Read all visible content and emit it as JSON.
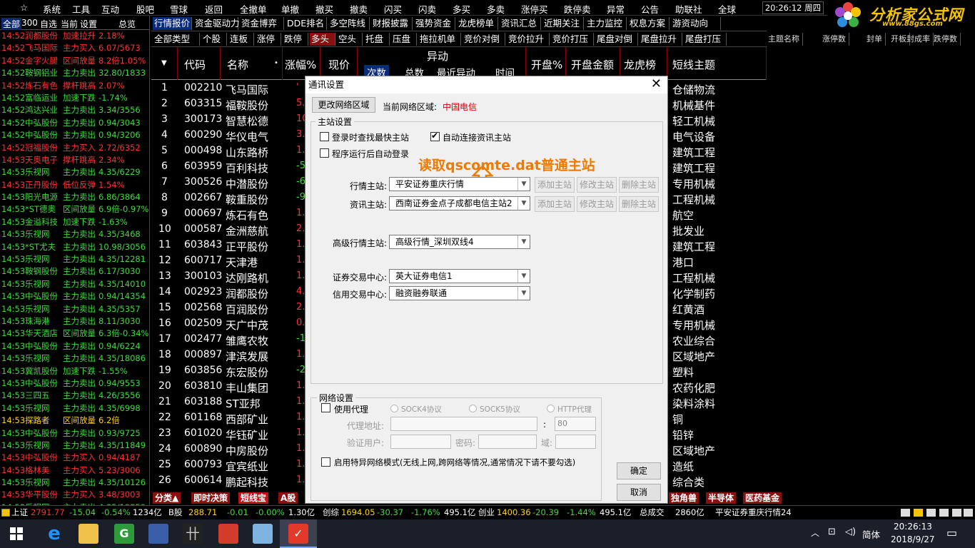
{
  "menu": [
    "☆",
    "系统",
    "工具",
    "互动",
    "股吧",
    "雪球",
    "返回",
    "全撤单",
    "单撤",
    "撤买",
    "撤卖",
    "闪买",
    "闪卖",
    "多买",
    "多卖",
    "涨停买",
    "跌停卖",
    "异常",
    "公告",
    "助联社",
    "全球"
  ],
  "clock": {
    "time": "20:26:12",
    "weekday": "周四"
  },
  "logo": {
    "title": "分析家公式网",
    "url": "www.88gs.com"
  },
  "left_tabs": [
    "全部",
    "300",
    "自选",
    "当前",
    "设置",
    "总览"
  ],
  "feed": [
    {
      "t": "14:52",
      "name": "润都股份",
      "act": "加速拉升",
      "val": "2.18%",
      "c": "r"
    },
    {
      "t": "14:52",
      "name": "飞马国际",
      "act": "主力买入",
      "val": "6.07/5673",
      "c": "r"
    },
    {
      "t": "14:52",
      "name": "金字火腿",
      "act": "区间放量",
      "val": "8.2倍1.05%",
      "c": "r"
    },
    {
      "t": "14:52",
      "name": "鞍钢铝业",
      "act": "主力卖出",
      "val": "32.80/1833",
      "c": "g"
    },
    {
      "t": "14:52",
      "name": "炼石有色",
      "act": "撑杆跳高",
      "val": "2.07%",
      "c": "r"
    },
    {
      "t": "14:52",
      "name": "富临运业",
      "act": "加速下跌",
      "val": "-1.74%",
      "c": "g"
    },
    {
      "t": "14:52",
      "name": "鸿达兴业",
      "act": "主力卖出",
      "val": "3.34/3556",
      "c": "g"
    },
    {
      "t": "14:52",
      "name": "中弘股份",
      "act": "主力卖出",
      "val": "0.94/3043",
      "c": "g"
    },
    {
      "t": "14:52",
      "name": "中弘股份",
      "act": "主力卖出",
      "val": "0.94/3206",
      "c": "g"
    },
    {
      "t": "14:52",
      "name": "冠福股份",
      "act": "主力买入",
      "val": "2.72/6352",
      "c": "r"
    },
    {
      "t": "14:53",
      "name": "天奥电子",
      "act": "撑杆跳高",
      "val": "2.34%",
      "c": "r"
    },
    {
      "t": "14:53",
      "name": "乐视网",
      "act": "主力卖出",
      "val": "4.35/6229",
      "c": "g"
    },
    {
      "t": "14:53",
      "name": "正丹股份",
      "act": "低位反弹",
      "val": "1.54%",
      "c": "r"
    },
    {
      "t": "14:53",
      "name": "阳光电源",
      "act": "主力卖出",
      "val": "6.86/3864",
      "c": "g"
    },
    {
      "t": "14:53",
      "name": "*ST德奥",
      "act": "区间放量",
      "val": "6.9倍-0.97%",
      "c": "g"
    },
    {
      "t": "14:53",
      "name": "金溢科技",
      "act": "加速下跌",
      "val": "-1.63%",
      "c": "g"
    },
    {
      "t": "14:53",
      "name": "乐视网",
      "act": "主力卖出",
      "val": "4.35/3468",
      "c": "g"
    },
    {
      "t": "14:53",
      "name": "*ST尤夫",
      "act": "主力卖出",
      "val": "10.98/3056",
      "c": "g"
    },
    {
      "t": "14:53",
      "name": "乐视网",
      "act": "主力卖出",
      "val": "4.35/12281",
      "c": "g"
    },
    {
      "t": "14:53",
      "name": "鞍钢股份",
      "act": "主力卖出",
      "val": "6.17/3030",
      "c": "g"
    },
    {
      "t": "14:53",
      "name": "乐视网",
      "act": "主力卖出",
      "val": "4.35/14010",
      "c": "g"
    },
    {
      "t": "14:53",
      "name": "中弘股份",
      "act": "主力卖出",
      "val": "0.94/14354",
      "c": "g"
    },
    {
      "t": "14:53",
      "name": "乐视网",
      "act": "主力卖出",
      "val": "4.35/5357",
      "c": "g"
    },
    {
      "t": "14:53",
      "name": "珠海港",
      "act": "主力卖出",
      "val": "8.11/3030",
      "c": "g"
    },
    {
      "t": "14:53",
      "name": "华天酒店",
      "act": "区间放量",
      "val": "6.3倍-0.34%",
      "c": "g"
    },
    {
      "t": "14:53",
      "name": "中弘股份",
      "act": "主力卖出",
      "val": "0.94/6224",
      "c": "g"
    },
    {
      "t": "14:53",
      "name": "乐视网",
      "act": "主力卖出",
      "val": "4.35/18086",
      "c": "g"
    },
    {
      "t": "14:53",
      "name": "冀凯股份",
      "act": "加速下跌",
      "val": "-1.55%",
      "c": "g"
    },
    {
      "t": "14:53",
      "name": "中弘股份",
      "act": "主力卖出",
      "val": "0.94/9553",
      "c": "g"
    },
    {
      "t": "14:53",
      "name": "三四五",
      "act": "主力卖出",
      "val": "4.26/3556",
      "c": "g"
    },
    {
      "t": "14:53",
      "name": "乐视网",
      "act": "主力卖出",
      "val": "4.35/6998",
      "c": "g"
    },
    {
      "t": "14:53",
      "name": "探路者",
      "act": "区间放量",
      "val": "6.2倍",
      "c": "y"
    },
    {
      "t": "14:53",
      "name": "中弘股份",
      "act": "主力卖出",
      "val": "0.93/9725",
      "c": "g"
    },
    {
      "t": "14:53",
      "name": "乐视网",
      "act": "主力卖出",
      "val": "4.35/11849",
      "c": "g"
    },
    {
      "t": "14:53",
      "name": "中弘股份",
      "act": "主力买入",
      "val": "0.94/4187",
      "c": "r"
    },
    {
      "t": "14:53",
      "name": "格林美",
      "act": "主力买入",
      "val": "5.23/3006",
      "c": "r"
    },
    {
      "t": "14:53",
      "name": "乐视网",
      "act": "主力卖出",
      "val": "4.35/10126",
      "c": "g"
    },
    {
      "t": "14:53",
      "name": "华平股份",
      "act": "主力买入",
      "val": "3.48/3003",
      "c": "r"
    },
    {
      "t": "14:53",
      "name": "乐视网",
      "act": "主力卖出",
      "val": "4.35/19859",
      "c": "g"
    },
    {
      "t": "14:53",
      "name": "炼石有色",
      "act": "高位回落",
      "val": "-1.55%",
      "c": "g"
    },
    {
      "t": "14:53",
      "name": "炼石有色",
      "act": "单笔冲跌",
      "val": "-4.45%",
      "c": "g"
    }
  ],
  "tabs_row1": [
    "行情报价",
    "资金驱动力",
    "资金博弈",
    "DDE排名",
    "多空阵线",
    "财报披露",
    "强势资金",
    "龙虎榜单",
    "资讯汇总",
    "近期关注",
    "主力监控",
    "权息方案",
    "游资动向"
  ],
  "tabs_row2": [
    "全部类型",
    "个股",
    "连板",
    "涨停",
    "跌停",
    "多头",
    "空头",
    "托盘",
    "压盘",
    "拖拉机单",
    "竞价对倒",
    "竞价拉升",
    "竞价打压",
    "尾盘对倒",
    "尾盘拉升",
    "尾盘打压"
  ],
  "right_tabs": [
    "主题名称",
    "涨停数",
    "封单",
    "开板",
    "封成率",
    "跌停数"
  ],
  "grid_head": {
    "code": "代码",
    "name": "名称",
    "pct": "涨幅%",
    "price": "现价",
    "anomaly": "异动",
    "times": "次数",
    "total": "总数",
    "recent": "最近异动",
    "time": "时间",
    "open_pct": "开盘%",
    "open_amt": "开盘金额",
    "dragon": "龙虎榜",
    "theme": "短线主题"
  },
  "rows": [
    {
      "n": "1",
      "code": "002210",
      "name": "飞马国际",
      "pv": "'",
      "pc": "r",
      "theme": "仓储物流"
    },
    {
      "n": "2",
      "code": "603315",
      "name": "福鞍股份",
      "pv": "5.",
      "pc": "r",
      "theme": "机械基件"
    },
    {
      "n": "3",
      "code": "300173",
      "name": "智慧松德",
      "pv": "10.",
      "pc": "r",
      "theme": "轻工机械"
    },
    {
      "n": "4",
      "code": "600290",
      "name": "华仪电气",
      "pv": "3.",
      "pc": "r",
      "theme": "电气设备"
    },
    {
      "n": "5",
      "code": "000498",
      "name": "山东路桥",
      "pv": "1.",
      "pc": "r",
      "theme": "建筑工程"
    },
    {
      "n": "6",
      "code": "603959",
      "name": "百利科技",
      "pv": "-5.",
      "pc": "g",
      "theme": "建筑工程"
    },
    {
      "n": "7",
      "code": "300526",
      "name": "中潜股份",
      "pv": "-6.",
      "pc": "g",
      "theme": "专用机械"
    },
    {
      "n": "8",
      "code": "002667",
      "name": "鞍重股份",
      "pv": "-9.",
      "pc": "g",
      "theme": "工程机械"
    },
    {
      "n": "9",
      "code": "000697",
      "name": "炼石有色",
      "pv": "1.",
      "pc": "r",
      "theme": "航空"
    },
    {
      "n": "10",
      "code": "000587",
      "name": "金洲慈航",
      "pv": "2.",
      "pc": "r",
      "theme": "批发业"
    },
    {
      "n": "11",
      "code": "603843",
      "name": "正平股份",
      "pv": "1.",
      "pc": "r",
      "theme": "建筑工程"
    },
    {
      "n": "12",
      "code": "600717",
      "name": "天津港",
      "pv": "1.",
      "pc": "r",
      "theme": "港口"
    },
    {
      "n": "13",
      "code": "300103",
      "name": "达刚路机",
      "pv": "1.",
      "pc": "r",
      "theme": "工程机械"
    },
    {
      "n": "14",
      "code": "002923",
      "name": "润都股份",
      "pv": "4.",
      "pc": "r",
      "theme": "化学制药"
    },
    {
      "n": "15",
      "code": "002568",
      "name": "百润股份",
      "pv": "2.",
      "pc": "r",
      "theme": "红黄酒"
    },
    {
      "n": "16",
      "code": "002509",
      "name": "天广中茂",
      "pv": "0.",
      "pc": "r",
      "theme": "专用机械"
    },
    {
      "n": "17",
      "code": "002477",
      "name": "雏鹰农牧",
      "pv": "-1.",
      "pc": "g",
      "theme": "农业综合"
    },
    {
      "n": "18",
      "code": "000897",
      "name": "津滨发展",
      "pv": "1.",
      "pc": "r",
      "theme": "区域地产"
    },
    {
      "n": "19",
      "code": "603856",
      "name": "东宏股份",
      "pv": "-2.",
      "pc": "g",
      "theme": "塑料"
    },
    {
      "n": "20",
      "code": "603810",
      "name": "丰山集团",
      "pv": "1.",
      "pc": "r",
      "theme": "农药化肥"
    },
    {
      "n": "21",
      "code": "603188",
      "name": "ST亚邦",
      "pv": "1.",
      "pc": "r",
      "theme": "染料涂料"
    },
    {
      "n": "22",
      "code": "601168",
      "name": "西部矿业",
      "pv": "1.",
      "pc": "r",
      "theme": "铜"
    },
    {
      "n": "23",
      "code": "601020",
      "name": "华钰矿业",
      "pv": "1.",
      "pc": "r",
      "theme": "铅锌"
    },
    {
      "n": "24",
      "code": "600890",
      "name": "中房股份",
      "pv": "1.",
      "pc": "r",
      "theme": "区域地产"
    },
    {
      "n": "25",
      "code": "600793",
      "name": "宜宾纸业",
      "pv": "1.",
      "pc": "r",
      "theme": "造纸"
    },
    {
      "n": "26",
      "code": "600614",
      "name": "鹏起科技",
      "pv": "1.",
      "pc": "r",
      "theme": "综合类"
    }
  ],
  "bottom_tabs": [
    "分类▲",
    "即时决策",
    "短线宝",
    "A股"
  ],
  "right_bottom_tabs": [
    "独角兽",
    "半导体",
    "医药基金"
  ],
  "status": {
    "sh_label": "上证",
    "sh_val": "2791.77",
    "sh_chg": "-15.04",
    "sh_pct": "-0.54%",
    "sh_amt": "1234亿",
    "b_label": "B股",
    "b_val": "288.71",
    "b_chg": "-0.01",
    "b_pct": "-0.00%",
    "b_amt": "1.30亿",
    "cz_label": "创综",
    "cz_val": "1694.05",
    "cz_chg": "-30.37",
    "cz_pct": "-1.76%",
    "cz_amt": "495.1亿",
    "cy_label": "创业",
    "cy_val": "1400.36",
    "cy_chg": "-20.39",
    "cy_pct": "-1.44%",
    "cy_amt": "495.1亿",
    "total_label": "总成交",
    "total_val": "2860亿",
    "server": "平安证券重庆行情24"
  },
  "taskbar": {
    "time": "20:26:13",
    "date": "2018/9/27",
    "ime": "简体"
  },
  "dialog": {
    "title": "通讯设置",
    "change_btn": "更改网络区域",
    "region_label": "当前网络区域:",
    "region_value": "中国电信",
    "master_group": "主站设置",
    "chk_fastest": "登录时查找最快主站",
    "chk_auto_info": "自动连接资讯主站",
    "chk_auto_start": "程序运行后自动登录",
    "annotation": "读取qscomte.dat普通主站",
    "quote_label": "行情主站:",
    "quote_value": "平安证券重庆行情",
    "info_label": "资讯主站:",
    "info_value": "西南证券金点子成都电信主站2",
    "add_btn": "添加主站",
    "edit_btn": "修改主站",
    "del_btn": "删除主站",
    "adv_label": "高级行情主站:",
    "adv_value": "高级行情_深圳双线4",
    "trade_label": "证券交易中心:",
    "trade_value": "英大证券电信1",
    "credit_label": "信用交易中心:",
    "credit_value": "融资融券联通",
    "net_group": "网络设置",
    "use_proxy": "使用代理",
    "sock4": "SOCK4协议",
    "sock5": "SOCK5协议",
    "http": "HTTP代理",
    "proxy_addr": "代理地址:",
    "port": "80",
    "auth_user": "验证用户:",
    "password": "密码:",
    "domain": "域:",
    "special": "启用特异网络模式(无线上网,跨网络等情况,通常情况下请不要勾选)",
    "ok": "确定",
    "cancel": "取消"
  }
}
